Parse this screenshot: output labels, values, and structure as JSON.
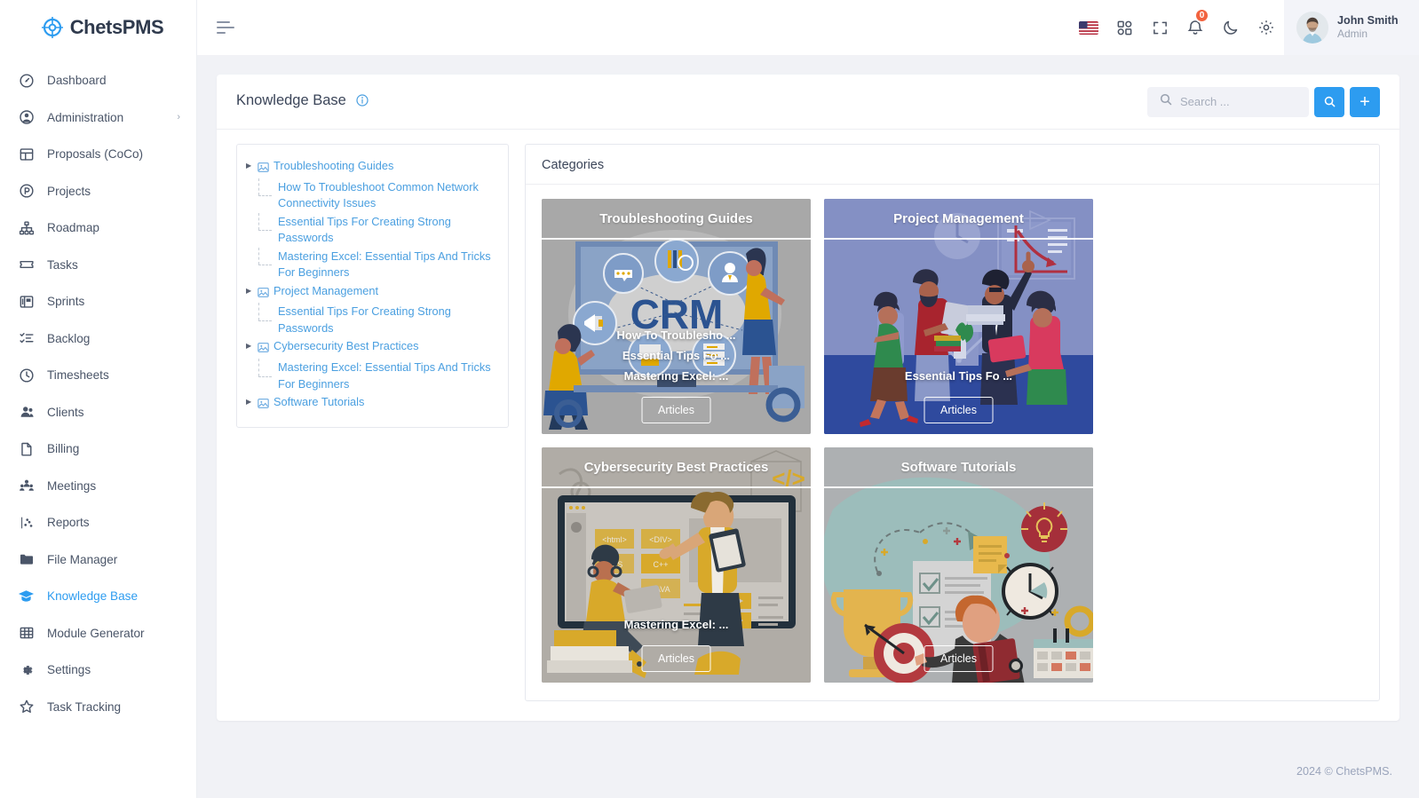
{
  "brand": {
    "name": "ChetsPMS",
    "logo_icon": "chets-logo-icon"
  },
  "sidebar": {
    "items": [
      {
        "label": "Dashboard",
        "icon": "speedometer-icon",
        "active": false,
        "caret": ""
      },
      {
        "label": "Administration",
        "icon": "user-circle-icon",
        "active": false,
        "caret": "›"
      },
      {
        "label": "Proposals (CoCo)",
        "icon": "layout-icon",
        "active": false,
        "caret": ""
      },
      {
        "label": "Projects",
        "icon": "circle-p-icon",
        "active": false,
        "caret": ""
      },
      {
        "label": "Roadmap",
        "icon": "sitemap-icon",
        "active": false,
        "caret": ""
      },
      {
        "label": "Tasks",
        "icon": "ticket-icon",
        "active": false,
        "caret": ""
      },
      {
        "label": "Sprints",
        "icon": "kanban-icon",
        "active": false,
        "caret": ""
      },
      {
        "label": "Backlog",
        "icon": "checklist-icon",
        "active": false,
        "caret": ""
      },
      {
        "label": "Timesheets",
        "icon": "clock-icon",
        "active": false,
        "caret": ""
      },
      {
        "label": "Clients",
        "icon": "users-icon",
        "active": false,
        "caret": ""
      },
      {
        "label": "Billing",
        "icon": "file-icon",
        "active": false,
        "caret": ""
      },
      {
        "label": "Meetings",
        "icon": "people-group-icon",
        "active": false,
        "caret": ""
      },
      {
        "label": "Reports",
        "icon": "chart-scatter-icon",
        "active": false,
        "caret": ""
      },
      {
        "label": "File Manager",
        "icon": "folder-icon",
        "active": false,
        "caret": ""
      },
      {
        "label": "Knowledge Base",
        "icon": "graduation-cap-icon",
        "active": true,
        "caret": ""
      },
      {
        "label": "Module Generator",
        "icon": "grid-table-icon",
        "active": false,
        "caret": ""
      },
      {
        "label": "Settings",
        "icon": "gear-icon",
        "active": false,
        "caret": ""
      },
      {
        "label": "Task Tracking",
        "icon": "star-icon",
        "active": false,
        "caret": ""
      }
    ]
  },
  "topbar": {
    "menu_toggle_icon": "hamburger-icon",
    "icons": [
      {
        "name": "flag-us-icon"
      },
      {
        "name": "apps-grid-icon"
      },
      {
        "name": "fullscreen-icon"
      },
      {
        "name": "bell-icon"
      },
      {
        "name": "moon-icon"
      },
      {
        "name": "gear-icon"
      }
    ],
    "notification_count": "0",
    "user": {
      "name": "John Smith",
      "role": "Admin",
      "avatar_icon": "user-avatar"
    }
  },
  "page": {
    "title": "Knowledge Base",
    "info_icon": "info-circle-icon"
  },
  "search": {
    "placeholder": "Search ...",
    "value": "",
    "icon": "search-icon",
    "submit_icon": "search-icon",
    "add_label": "+"
  },
  "tree": {
    "nodes": [
      {
        "label": "Troubleshooting Guides",
        "icon": "folder-image-icon",
        "children": [
          "How To Troubleshoot Common Network Connectivity Issues",
          "Essential Tips For Creating Strong Passwords",
          "Mastering Excel: Essential Tips And Tricks For Beginners"
        ]
      },
      {
        "label": "Project Management",
        "icon": "folder-image-icon",
        "children": [
          "Essential Tips For Creating Strong Passwords"
        ]
      },
      {
        "label": "Cybersecurity Best Practices",
        "icon": "folder-image-icon",
        "children": [
          "Mastering Excel: Essential Tips And Tricks For Beginners"
        ]
      },
      {
        "label": "Software Tutorials",
        "icon": "folder-image-icon",
        "children": []
      }
    ]
  },
  "categories": {
    "heading": "Categories",
    "cards": [
      {
        "title": "Troubleshooting Guides",
        "links": [
          "How To Troublesho ...",
          "Essential Tips Fo ...",
          "Mastering Excel: ..."
        ],
        "button": "Articles",
        "art": "crm-illustration",
        "bg": "#a8a8a8"
      },
      {
        "title": "Project Management",
        "links": [
          "Essential Tips Fo ..."
        ],
        "button": "Articles",
        "art": "team-meeting-illustration",
        "bg": "#8490c4"
      },
      {
        "title": "Cybersecurity Best Practices",
        "links": [
          "Mastering Excel: ..."
        ],
        "button": "Articles",
        "art": "coding-illustration",
        "bg": "#b0aca6"
      },
      {
        "title": "Software Tutorials",
        "links": [],
        "button": "Articles",
        "art": "productivity-illustration",
        "bg": "#adb0b2"
      }
    ]
  },
  "footer": {
    "text": "2024 © ChetsPMS."
  },
  "colors": {
    "accent": "#2d9cf0",
    "link": "#4a9fe0",
    "badge": "#f2633f",
    "sidebar_bg": "#ffffff",
    "page_bg": "#f1f2f6",
    "text": "#3b4559"
  }
}
